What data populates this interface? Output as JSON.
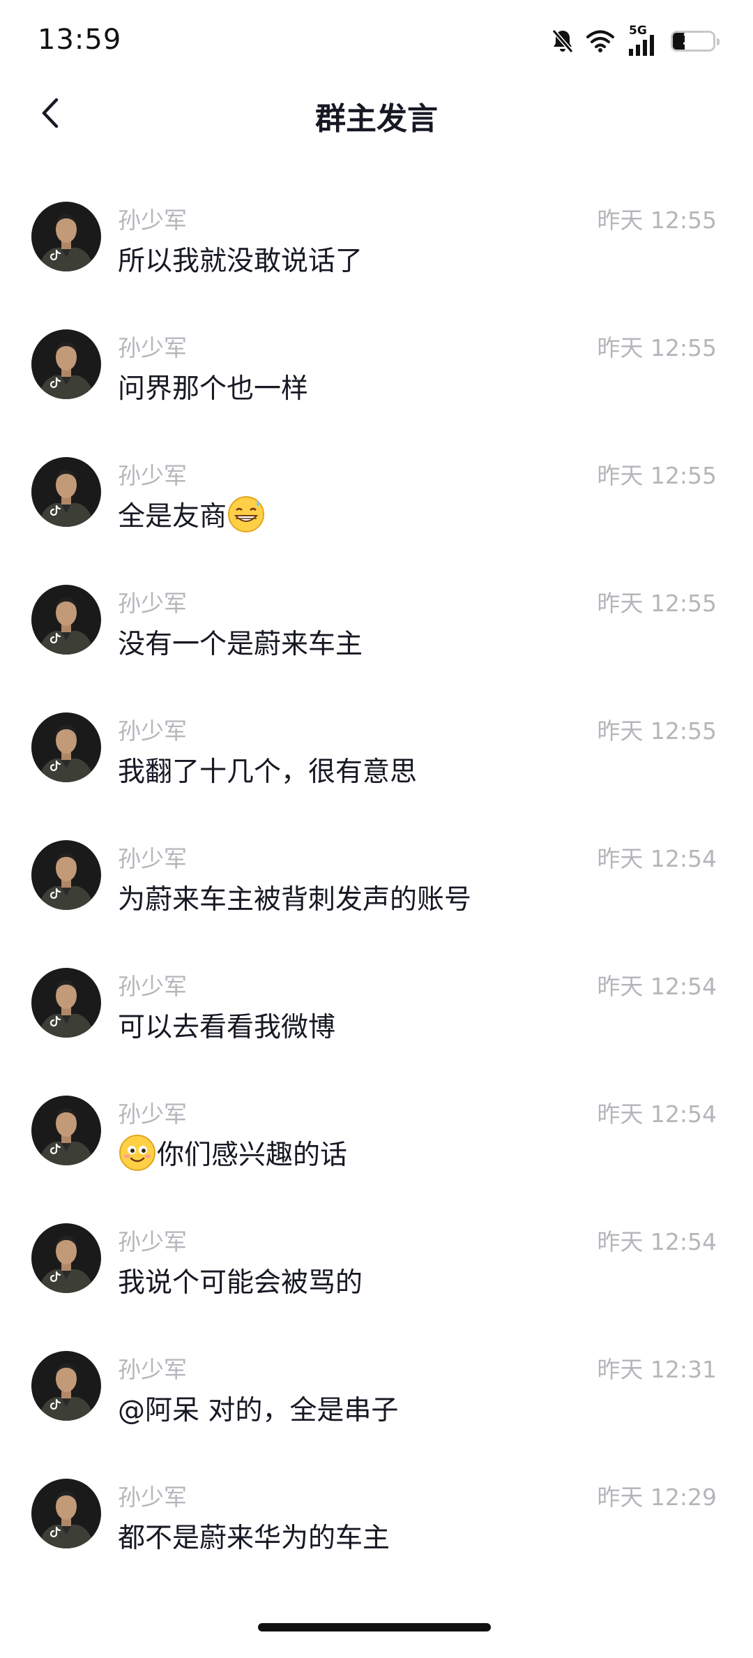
{
  "status_bar": {
    "time": "13:59",
    "network": "5G",
    "battery_level": "30"
  },
  "header": {
    "title": "群主发言"
  },
  "messages": [
    {
      "sender": "孙少军",
      "time": "昨天 12:55",
      "text": "所以我就没敢说话了"
    },
    {
      "sender": "孙少军",
      "time": "昨天 12:55",
      "text": "问界那个也一样"
    },
    {
      "sender": "孙少军",
      "time": "昨天 12:55",
      "text": "全是友商",
      "emoji_after": "grinning-sweat-emoji"
    },
    {
      "sender": "孙少军",
      "time": "昨天 12:55",
      "text": "没有一个是蔚来车主"
    },
    {
      "sender": "孙少军",
      "time": "昨天 12:55",
      "text": "我翻了十几个，很有意思"
    },
    {
      "sender": "孙少军",
      "time": "昨天 12:54",
      "text": "为蔚来车主被背刺发声的账号"
    },
    {
      "sender": "孙少军",
      "time": "昨天 12:54",
      "text": "可以去看看我微博"
    },
    {
      "sender": "孙少军",
      "time": "昨天 12:54",
      "text": "你们感兴趣的话",
      "emoji_before": "smile-emoji"
    },
    {
      "sender": "孙少军",
      "time": "昨天 12:54",
      "text": "我说个可能会被骂的"
    },
    {
      "sender": "孙少军",
      "time": "昨天 12:31",
      "text": "@阿呆 对的，全是串子"
    },
    {
      "sender": "孙少军",
      "time": "昨天 12:29",
      "text": "都不是蔚来华为的车主"
    }
  ],
  "colors": {
    "text_primary": "#161823",
    "text_secondary": "#b5b6bb",
    "background": "#ffffff"
  }
}
